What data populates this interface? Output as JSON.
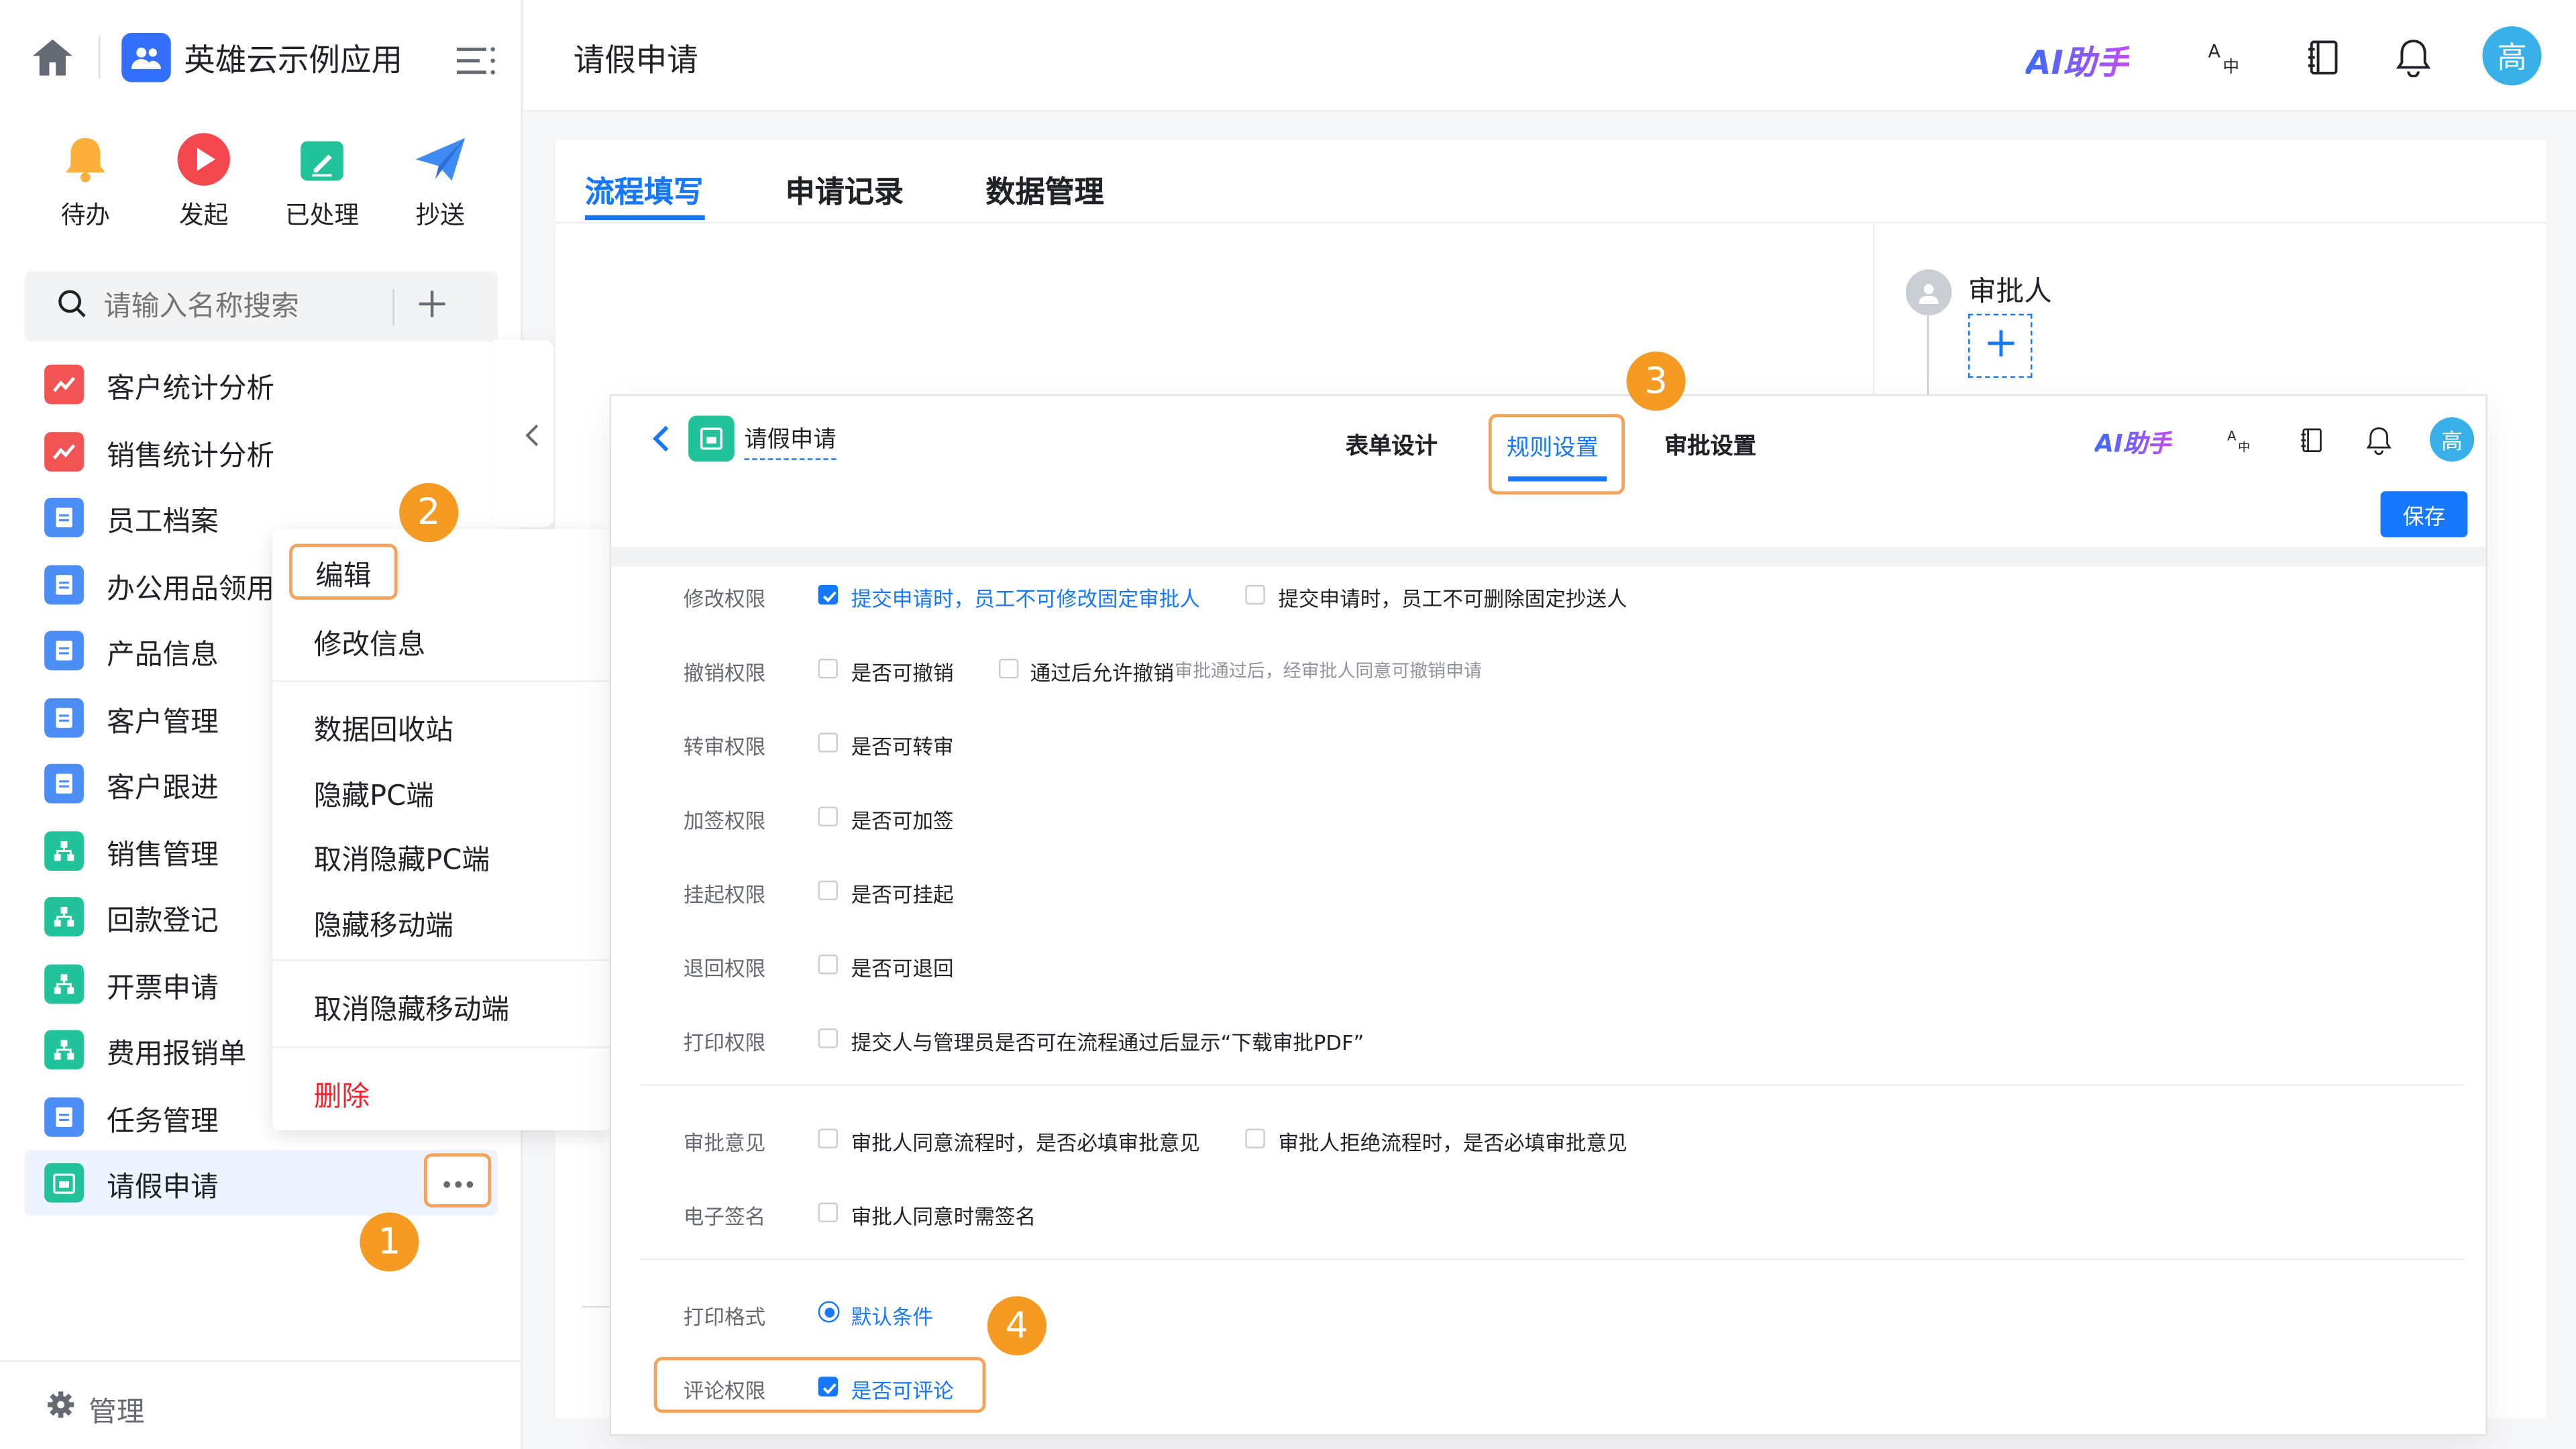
{
  "sidebar": {
    "app_name": "英雄云示例应用",
    "quick_actions": [
      "待办",
      "发起",
      "已处理",
      "抄送"
    ],
    "search_placeholder": "请输入名称搜索",
    "items": [
      "客户统计分析",
      "销售统计分析",
      "员工档案",
      "办公用品领用",
      "产品信息",
      "客户管理",
      "客户跟进",
      "销售管理",
      "回款登记",
      "开票申请",
      "费用报销单",
      "任务管理",
      "请假申请"
    ],
    "footer": "管理"
  },
  "context_menu": [
    "编辑",
    "修改信息",
    "数据回收站",
    "隐藏PC端",
    "取消隐藏PC端",
    "隐藏移动端",
    "取消隐藏移动端",
    "删除"
  ],
  "header": {
    "title": "请假申请",
    "ai_label": "AI助手",
    "avatar": "高"
  },
  "tabs": [
    "流程填写",
    "申请记录",
    "数据管理"
  ],
  "approver": {
    "label": "审批人"
  },
  "overlay": {
    "title": "请假申请",
    "tabs": [
      "表单设计",
      "规则设置",
      "审批设置"
    ],
    "ai_label": "AI助手",
    "avatar": "高",
    "save": "保存",
    "rules": [
      {
        "label": "修改权限",
        "options": [
          {
            "text": "提交申请时，员工不可修改固定审批人",
            "checked": true
          },
          {
            "text": "提交申请时，员工不可删除固定抄送人",
            "checked": false
          }
        ]
      },
      {
        "label": "撤销权限",
        "options": [
          {
            "text": "是否可撤销",
            "checked": false
          },
          {
            "text": "通过后允许撤销",
            "checked": false,
            "note": "审批通过后，经审批人同意可撤销申请"
          }
        ]
      },
      {
        "label": "转审权限",
        "options": [
          {
            "text": "是否可转审",
            "checked": false
          }
        ]
      },
      {
        "label": "加签权限",
        "options": [
          {
            "text": "是否可加签",
            "checked": false
          }
        ]
      },
      {
        "label": "挂起权限",
        "options": [
          {
            "text": "是否可挂起",
            "checked": false
          }
        ]
      },
      {
        "label": "退回权限",
        "options": [
          {
            "text": "是否可退回",
            "checked": false
          }
        ]
      },
      {
        "label": "打印权限",
        "options": [
          {
            "text": "提交人与管理员是否可在流程通过后显示“下载审批PDF”",
            "checked": false
          }
        ]
      },
      {
        "label": "审批意见",
        "options": [
          {
            "text": "审批人同意流程时，是否必填审批意见",
            "checked": false
          },
          {
            "text": "审批人拒绝流程时，是否必填审批意见",
            "checked": false
          }
        ]
      },
      {
        "label": "电子签名",
        "options": [
          {
            "text": "审批人同意时需签名",
            "checked": false
          }
        ]
      },
      {
        "label": "打印格式",
        "options": [
          {
            "text": "默认条件",
            "checked": true
          }
        ]
      },
      {
        "label": "评论权限",
        "options": [
          {
            "text": "是否可评论",
            "checked": true
          }
        ]
      }
    ]
  },
  "badges": [
    "1",
    "2",
    "3",
    "4"
  ],
  "colors": {
    "primary": "#1677ff",
    "annotation": "#f59a23",
    "highlight_border": "#f5a35a",
    "danger": "#f5222d"
  }
}
